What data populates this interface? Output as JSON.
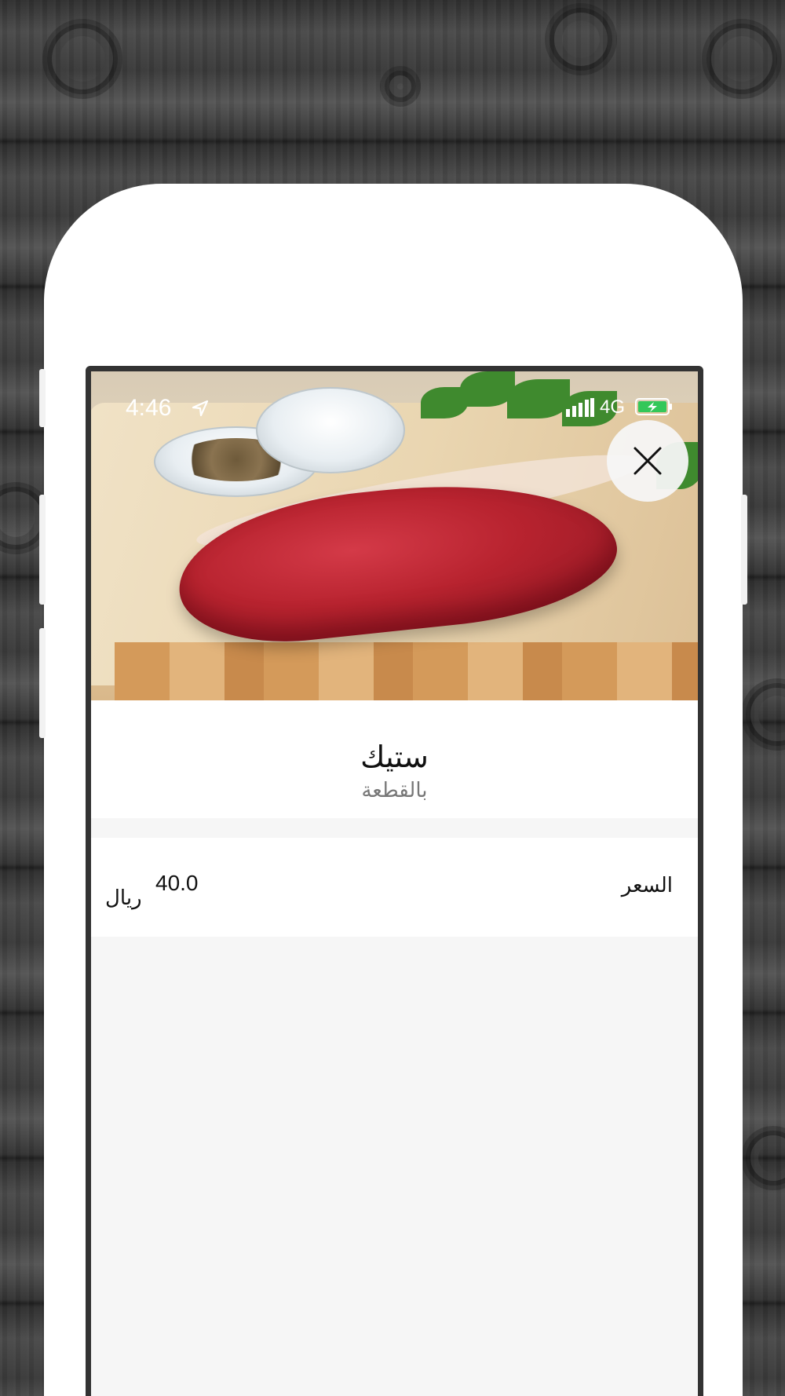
{
  "status_bar": {
    "time": "4:46",
    "network": "4G",
    "icons": [
      "location-arrow-icon",
      "signal-icon",
      "battery-charging-icon"
    ],
    "battery_color": "#34c759"
  },
  "product": {
    "image": "steak-photo",
    "name": "ستيك",
    "unit": "بالقطعة"
  },
  "price": {
    "label": "السعر",
    "value": "40.0",
    "currency": "ريال"
  },
  "actions": {
    "close_icon": "close-icon"
  }
}
